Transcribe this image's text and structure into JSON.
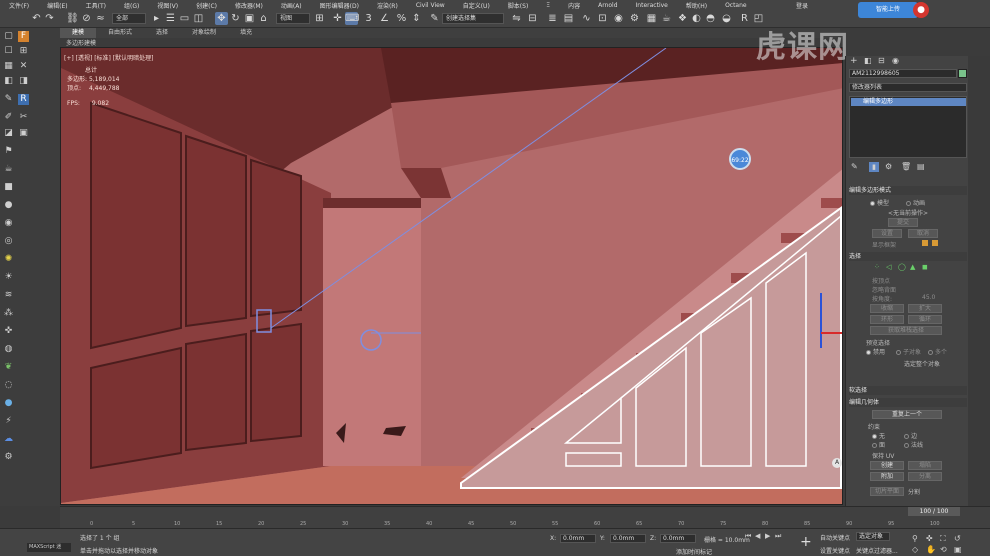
{
  "menu": {
    "items": [
      "文件(F)",
      "编辑(E)",
      "工具(T)",
      "组(G)",
      "视图(V)",
      "创建(C)",
      "修改器(M)",
      "动画(A)",
      "图形编辑器(D)",
      "渲染(R)",
      "Civil View",
      "自定义(U)",
      "脚本(S)",
      "Ξ",
      "内容",
      "Arnold",
      "Interactive",
      "帮助(H)",
      "Octane"
    ],
    "signin": "登录",
    "workspace": "工作区"
  },
  "toolbar": {
    "selection_filter": "全部",
    "view_dropdown": "视图",
    "selection_set": "创建选择集"
  },
  "ribbon": {
    "tabs": [
      "建模",
      "自由形式",
      "选择",
      "对象绘制",
      "填充"
    ],
    "subtitle": "多边形建模"
  },
  "viewport": {
    "label": "[+] [透视] [标准] [默认明暗处理]",
    "stats": {
      "heading": "总计",
      "polys_label": "多边形:",
      "polys_value": "5,189,014",
      "verts_label": "顶点:",
      "verts_value": "4,449,788",
      "fps_label": "FPS:",
      "fps_value": "9.082"
    },
    "timer": "69:22"
  },
  "command_panel": {
    "object_name": "AM2112998605",
    "object_color": "#79c28a",
    "modifier_list_label": "修改器列表",
    "stack_item": "编辑多边形",
    "rollouts": {
      "edit_poly_mode": {
        "title": "编辑多边形模式",
        "model": "模型",
        "animate": "动画",
        "no_op": "<无当前操作>",
        "commit": "提交",
        "settings": "设置",
        "cancel": "取消",
        "show_cage": "显示框架"
      },
      "selection": {
        "title": "选择",
        "by_vertex": "按顶点",
        "ignore_backfacing": "忽略背面",
        "by_angle": "按角度:",
        "angle_value": "45.0",
        "shrink": "收缩",
        "grow": "扩大",
        "ring": "环形",
        "loop": "循环",
        "get_stack_sel": "获取堆栈选择",
        "preview_sel": "预览选择",
        "off": "禁用",
        "subobject": "子对象",
        "multi": "多个",
        "whole_selected": "选定整个对象"
      },
      "soft_selection": {
        "title": "软选择"
      },
      "edit_geometry": {
        "title": "编辑几何体",
        "repeat_last": "重复上一个",
        "constraints": "约束",
        "none": "无",
        "edge": "边",
        "face": "面",
        "normal": "法线",
        "preserve_uvs": "保持 UV",
        "create": "创建",
        "collapse": "塌陷",
        "attach": "附加",
        "detach": "分离",
        "slice_plane": "切片平面",
        "split": "分割"
      }
    }
  },
  "timeline": {
    "slider": "100 / 100",
    "ticks": [
      "0",
      "5",
      "10",
      "15",
      "20",
      "25",
      "30",
      "35",
      "40",
      "45",
      "50",
      "55",
      "60",
      "65",
      "70",
      "75",
      "80",
      "85",
      "90",
      "95",
      "100"
    ]
  },
  "statusbar": {
    "maxscript": "MAXScript 迷",
    "selected": "选择了 1 个 组",
    "prompt": "单击并拖动以选择并移动对象",
    "x_label": "X:",
    "x_value": "0.0mm",
    "y_label": "Y:",
    "y_value": "0.0mm",
    "z_label": "Z:",
    "z_value": "0.0mm",
    "grid": "栅格 = 10.0mm",
    "add_time_tag": "添加时间标记",
    "auto_key": "自动关键点",
    "selected_obj": "选定对象",
    "set_key": "设置关键点",
    "key_filters": "关键点过滤器..."
  },
  "overlay": {
    "watermark": "虎课网",
    "upload": "智能上传",
    "badge_a": "A"
  }
}
